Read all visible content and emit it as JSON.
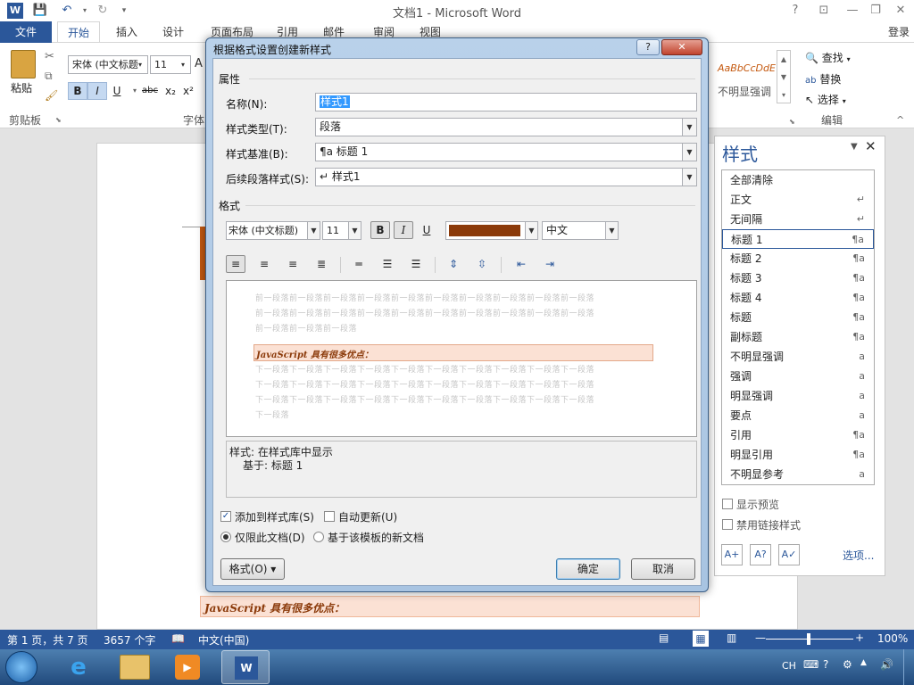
{
  "window": {
    "title": "文档1 - Microsoft Word",
    "help": "?",
    "controls": [
      "?",
      "⊡",
      "—",
      "❐",
      "✕"
    ]
  },
  "ribbon": {
    "tabs": [
      "文件",
      "开始",
      "插入",
      "设计",
      "页面布局",
      "引用",
      "邮件",
      "审阅",
      "视图"
    ],
    "login": "登录",
    "paste_label": "粘贴",
    "clipboard_group": "剪贴板",
    "font_group": "字体",
    "font_name": "宋体 (中文标题",
    "font_size": "11",
    "bold": "B",
    "italic": "I",
    "underline": "U",
    "strike": "abc",
    "sub": "x₂",
    "sup": "x²",
    "style_gallery_sample": "AaBbCcDdE",
    "style_gallery_label": "不明显强调",
    "find": "查找",
    "replace": "替换",
    "select": "选择",
    "edit_group": "编辑"
  },
  "styles_pane": {
    "title": "样式",
    "items": [
      {
        "label": "全部清除",
        "mark": ""
      },
      {
        "label": "正文",
        "mark": "↵"
      },
      {
        "label": "无间隔",
        "mark": "↵"
      },
      {
        "label": "标题 1",
        "mark": "¶a"
      },
      {
        "label": "标题 2",
        "mark": "¶a"
      },
      {
        "label": "标题 3",
        "mark": "¶a"
      },
      {
        "label": "标题 4",
        "mark": "¶a"
      },
      {
        "label": "标题",
        "mark": "¶a"
      },
      {
        "label": "副标题",
        "mark": "¶a"
      },
      {
        "label": "不明显强调",
        "mark": "a"
      },
      {
        "label": "强调",
        "mark": "a"
      },
      {
        "label": "明显强调",
        "mark": "a"
      },
      {
        "label": "要点",
        "mark": "a"
      },
      {
        "label": "引用",
        "mark": "¶a"
      },
      {
        "label": "明显引用",
        "mark": "¶a"
      },
      {
        "label": "不明显参考",
        "mark": "a"
      }
    ],
    "show_preview": "显示预览",
    "disable_linked": "禁用链接样式",
    "options": "选项..."
  },
  "dialog": {
    "title": "根据格式设置创建新样式",
    "help": "?",
    "close": "✕",
    "properties_section": "属性",
    "name_label": "名称(N):",
    "name_value": "样式1",
    "type_label": "样式类型(T):",
    "type_value": "段落",
    "based_label": "样式基准(B):",
    "based_value": "¶a 标题 1",
    "next_label": "后续段落样式(S):",
    "next_value": "↵ 样式1",
    "format_section": "格式",
    "font_name": "宋体 (中文标题)",
    "font_size": "11",
    "bold": "B",
    "italic": "I",
    "underline": "U",
    "color_hex": "#8b3a0a",
    "script": "中文",
    "preview_prev": [
      "前一段落前一段落前一段落前一段落前一段落前一段落前一段落前一段落前一段落前一段落",
      "前一段落前一段落前一段落前一段落前一段落前一段落前一段落前一段落前一段落前一段落",
      "前一段落前一段落前一段落"
    ],
    "preview_sample": "JavaScript 具有很多优点：",
    "preview_next": [
      "下一段落下一段落下一段落下一段落下一段落下一段落下一段落下一段落下一段落下一段落",
      "下一段落下一段落下一段落下一段落下一段落下一段落下一段落下一段落下一段落下一段落",
      "下一段落下一段落下一段落下一段落下一段落下一段落下一段落下一段落下一段落下一段落",
      "下一段落"
    ],
    "desc_line1": "样式: 在样式库中显示",
    "desc_line2": "基于: 标题 1",
    "add_to_gallery": "添加到样式库(S)",
    "auto_update": "自动更新(U)",
    "only_this_doc": "仅限此文档(D)",
    "new_docs_template": "基于该模板的新文档",
    "format_button": "格式(O) ▾",
    "ok": "确定",
    "cancel": "取消"
  },
  "document": {
    "heading_text": "JavaScript 具有很多优点：",
    "highlight_hex": "#fbe1d4"
  },
  "statusbar": {
    "page": "第 1 页，共 7 页",
    "words": "3657 个字",
    "language": "中文(中国)",
    "zoom": "100%"
  },
  "taskbar": {
    "ime": "CH"
  }
}
